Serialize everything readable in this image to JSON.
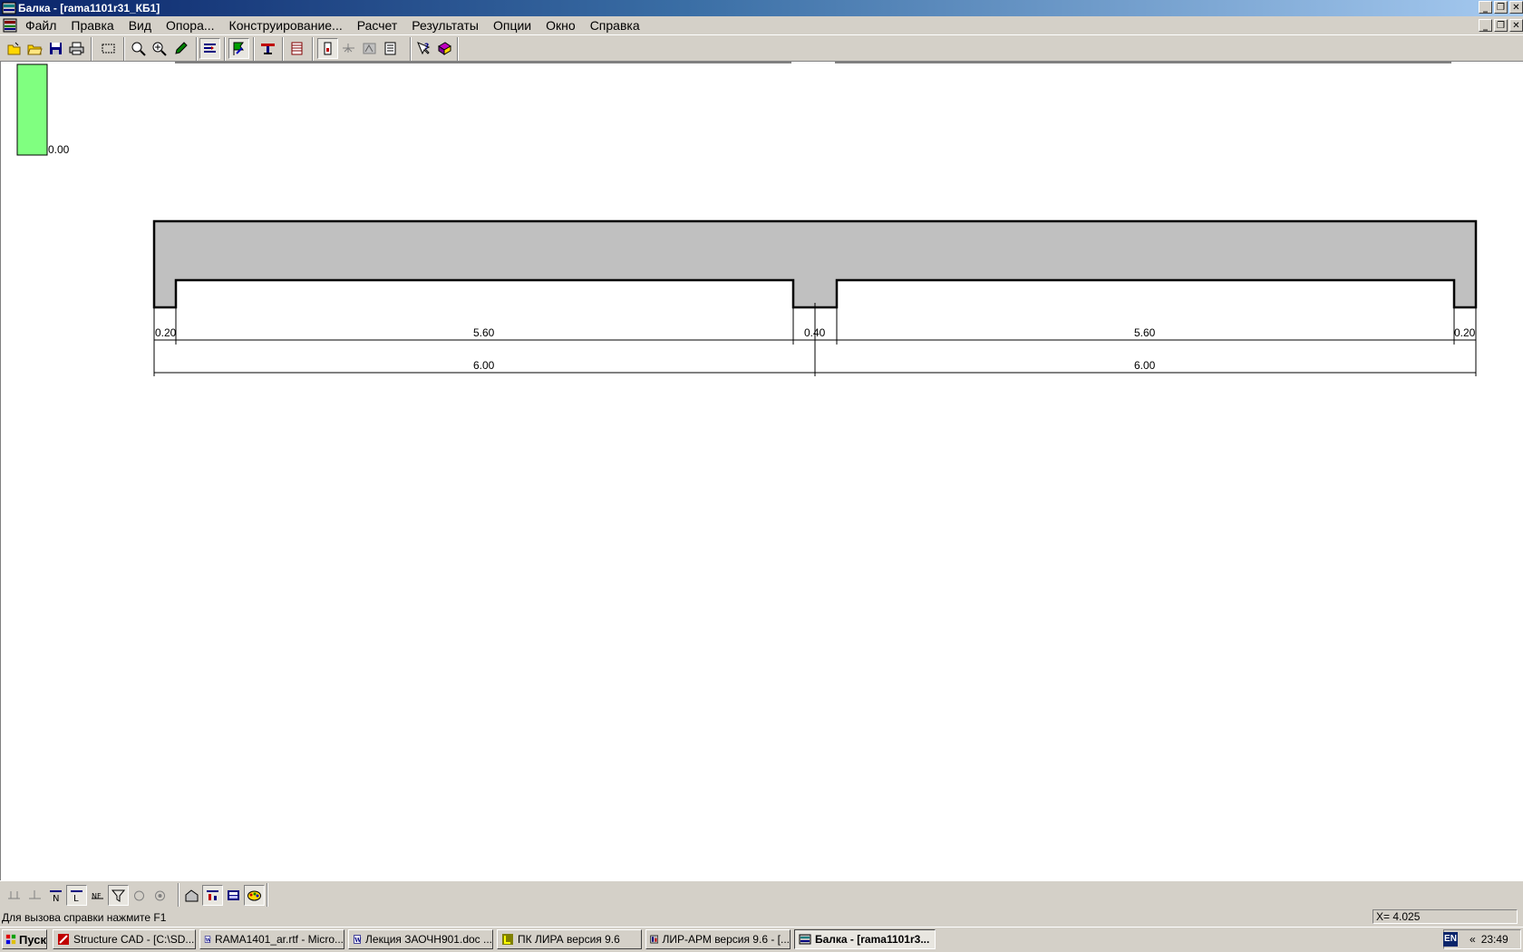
{
  "window": {
    "title": "Балка - [rama1101r31_КБ1]",
    "controls": {
      "minimize": "_",
      "restore": "❐",
      "close": "✕"
    }
  },
  "menu": {
    "items": [
      {
        "label": "Файл"
      },
      {
        "label": "Правка"
      },
      {
        "label": "Вид"
      },
      {
        "label": "Опора..."
      },
      {
        "label": "Конструирование..."
      },
      {
        "label": "Расчет"
      },
      {
        "label": "Результаты"
      },
      {
        "label": "Опции"
      },
      {
        "label": "Окно"
      },
      {
        "label": "Справка"
      }
    ]
  },
  "toolbar": {
    "icons": [
      "new-file-icon",
      "open-folder-icon",
      "save-icon",
      "print-icon",
      "select-rect-icon",
      "zoom-icon",
      "zoom-fit-icon",
      "pencil-icon",
      "supports-icon",
      "flag-icon",
      "section-icon",
      "table-icon",
      "property-icon",
      "scheme-icon",
      "diagram-icon",
      "report-icon",
      "context-help-icon",
      "help-book-icon"
    ]
  },
  "canvas": {
    "legend_value": "0.00",
    "beam": {
      "segments_top": [
        "0.20",
        "5.60",
        "0.40",
        "5.60",
        "0.20"
      ],
      "spans": [
        "6.00",
        "6.00"
      ]
    },
    "colors": {
      "beam_fill": "#c0c0c0",
      "legend_fill": "#80ff80"
    }
  },
  "bottom_toolbar": {
    "icons": [
      "load-n-icon",
      "load-p-icon",
      "force-n-icon",
      "moment-l-icon",
      "force-nr-icon",
      "filter-icon",
      "circle-icon",
      "circle2-icon",
      "building-icon",
      "bar-chart-icon",
      "table-chart-icon",
      "palette-icon"
    ]
  },
  "status": {
    "hint": "Для вызова справки нажмите F1",
    "coordinate": "X= 4.025"
  },
  "taskbar": {
    "start_label": "Пуск",
    "tasks": [
      {
        "label": "Structure CAD  - [C:\\SD..."
      },
      {
        "label": "RAMA1401_ar.rtf - Micro..."
      },
      {
        "label": "Лекция ЗАОЧН901.doc ..."
      },
      {
        "label": "ПК ЛИРА  версия 9.6"
      },
      {
        "label": "ЛИР-АРМ версия 9.6  - [..."
      },
      {
        "label": "Балка - [rama1101r3..."
      }
    ],
    "lang": "EN",
    "tray_arrows": "«",
    "clock": "23:49"
  }
}
